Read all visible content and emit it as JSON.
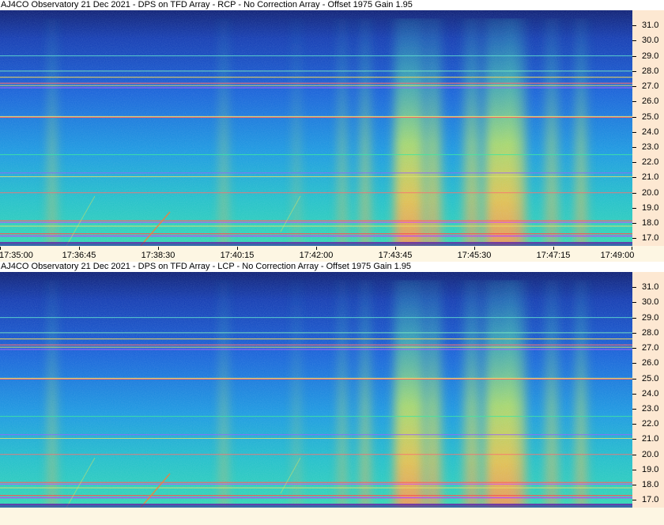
{
  "panels": [
    {
      "id": "rcp",
      "title": "AJ4CO Observatory 21 Dec 2021 - DPS on TFD Array  - RCP  -  No Correction Array  -  Offset 1975  Gain 1.95",
      "show_time_axis": true
    },
    {
      "id": "lcp",
      "title": "AJ4CO Observatory 21 Dec 2021 - DPS on TFD Array  - LCP  -  No Correction Array  -  Offset 1975  Gain 1.95",
      "show_time_axis": false
    }
  ],
  "frequency_axis": {
    "labels": [
      "31.0",
      "30.0",
      "29.0",
      "28.0",
      "27.0",
      "26.0",
      "25.0",
      "24.0",
      "23.0",
      "22.0",
      "21.0",
      "20.0",
      "19.0",
      "18.0",
      "17.0"
    ],
    "range_mhz": [
      16.5,
      32.0
    ]
  },
  "time_axis": {
    "labels": [
      "17:35:00",
      "17:36:45",
      "17:38:30",
      "17:40:15",
      "17:42:00",
      "17:43:45",
      "17:45:30",
      "17:47:15",
      "17:49:00"
    ]
  },
  "colors": {
    "background": "#fdf6e3",
    "freq_axis_bg": "#fde8d2",
    "colormap": [
      "#0a1a6b",
      "#1040c0",
      "#1a78e0",
      "#20b0d8",
      "#40d8a0",
      "#a0e860",
      "#f0e040",
      "#f8a040",
      "#f06060"
    ]
  }
}
